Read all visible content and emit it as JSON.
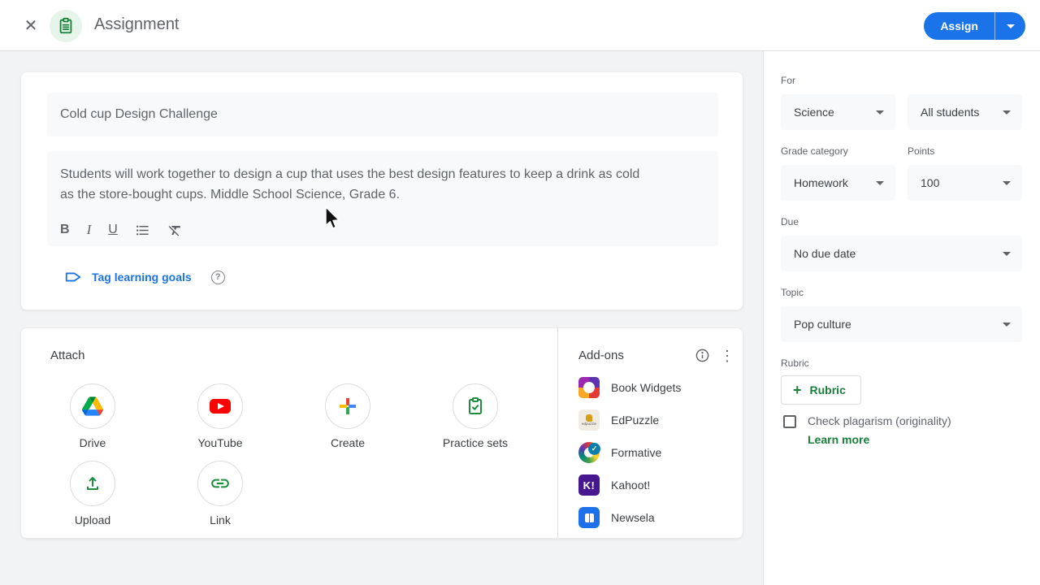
{
  "colors": {
    "accent_blue": "#1a73e8",
    "green": "#188038",
    "text_primary": "#3c4043",
    "text_secondary": "#5f6368",
    "field_bg": "#f8f9fa",
    "page_bg": "#f1f3f4"
  },
  "header": {
    "title": "Assignment",
    "assign_label": "Assign"
  },
  "composer": {
    "title_value": "Cold cup Design Challenge",
    "description_lines": [
      "Students will work together to design a cup that uses the best design features to keep a drink as cold",
      "as the store-bought cups. Middle School Science, Grade 6."
    ],
    "toolbar": {
      "bold": "B",
      "italic": "I",
      "underline": "U"
    },
    "tag_learning_goals_label": "Tag learning goals"
  },
  "attach": {
    "title": "Attach",
    "options": [
      {
        "label": "Drive",
        "icon": "google-drive-icon"
      },
      {
        "label": "YouTube",
        "icon": "youtube-icon"
      },
      {
        "label": "Create",
        "icon": "create-plus-icon"
      },
      {
        "label": "Practice sets",
        "icon": "practice-sets-icon"
      },
      {
        "label": "Upload",
        "icon": "upload-icon"
      },
      {
        "label": "Link",
        "icon": "link-icon"
      }
    ]
  },
  "addons": {
    "title": "Add-ons",
    "items": [
      {
        "label": "Book Widgets"
      },
      {
        "label": "EdPuzzle",
        "logo_text": "edpuzzle"
      },
      {
        "label": "Formative"
      },
      {
        "label": "Kahoot!",
        "logo_text": "K!"
      },
      {
        "label": "Newsela"
      }
    ]
  },
  "sidebar": {
    "for_label": "For",
    "class_select": {
      "value": "Science"
    },
    "students_select": {
      "value": "All students"
    },
    "grade_category_label": "Grade category",
    "grade_category_select": {
      "value": "Homework"
    },
    "points_label": "Points",
    "points_select": {
      "value": "100"
    },
    "due_label": "Due",
    "due_select": {
      "value": "No due date"
    },
    "topic_label": "Topic",
    "topic_select": {
      "value": "Pop culture"
    },
    "rubric_label": "Rubric",
    "rubric_button_label": "Rubric",
    "plagiarism_checkbox_label": "Check plagarism (originality)",
    "learn_more_label": "Learn more"
  }
}
